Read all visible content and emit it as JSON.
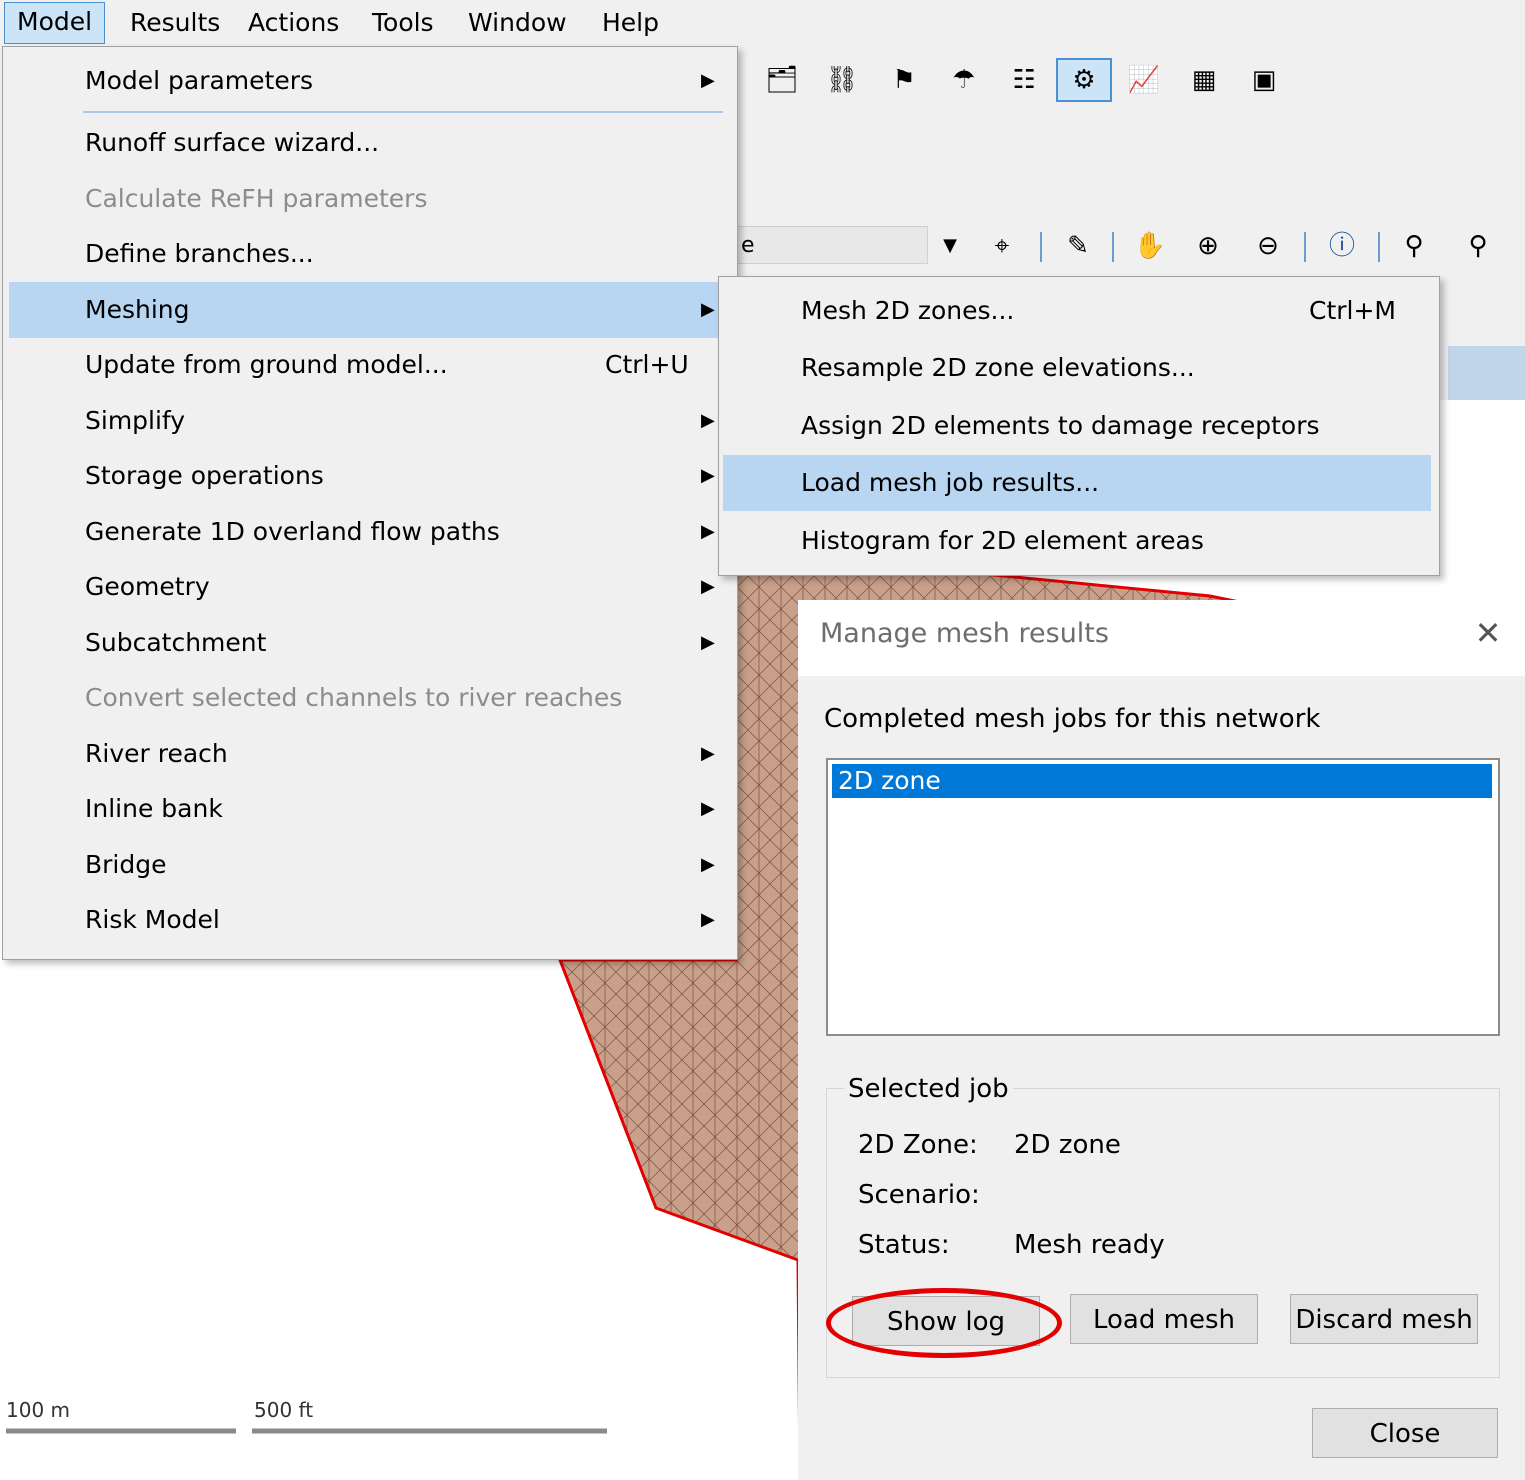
{
  "menubar": {
    "items": [
      "Model",
      "Results",
      "Actions",
      "Tools",
      "Window",
      "Help"
    ]
  },
  "toolbar": {
    "combo_value": "e"
  },
  "model_menu": {
    "items": [
      {
        "label": "Model parameters",
        "submenu": true
      },
      {
        "label": "Runoff surface wizard..."
      },
      {
        "label": "Calculate ReFH parameters",
        "disabled": true
      },
      {
        "label": "Define branches..."
      },
      {
        "label": "Meshing",
        "submenu": true,
        "highlighted": true
      },
      {
        "label": "Update from ground model...",
        "shortcut": "Ctrl+U"
      },
      {
        "label": "Simplify",
        "submenu": true
      },
      {
        "label": "Storage operations",
        "submenu": true
      },
      {
        "label": "Generate 1D overland flow paths",
        "submenu": true
      },
      {
        "label": "Geometry",
        "submenu": true
      },
      {
        "label": "Subcatchment",
        "submenu": true
      },
      {
        "label": "Convert selected channels to river reaches",
        "disabled": true
      },
      {
        "label": "River reach",
        "submenu": true
      },
      {
        "label": "Inline bank",
        "submenu": true
      },
      {
        "label": "Bridge",
        "submenu": true
      },
      {
        "label": "Risk Model",
        "submenu": true
      }
    ]
  },
  "meshing_submenu": {
    "items": [
      {
        "label": "Mesh 2D zones...",
        "shortcut": "Ctrl+M"
      },
      {
        "label": "Resample 2D zone elevations..."
      },
      {
        "label": "Assign 2D elements to damage receptors"
      },
      {
        "label": "Load mesh job results...",
        "highlighted": true
      },
      {
        "label": "Histogram for 2D element areas"
      }
    ]
  },
  "scale_bar": {
    "metric": "100 m",
    "imperial": "500 ft"
  },
  "dialog": {
    "title": "Manage mesh results",
    "list_label": "Completed mesh jobs for this network",
    "jobs": [
      "2D zone"
    ],
    "group_title": "Selected job",
    "zone_label": "2D Zone:",
    "zone_value": "2D zone",
    "scenario_label": "Scenario:",
    "scenario_value": "",
    "status_label": "Status:",
    "status_value": "Mesh ready",
    "buttons": {
      "show_log": "Show log",
      "load_mesh": "Load mesh",
      "discard_mesh": "Discard mesh",
      "close": "Close"
    }
  },
  "colors": {
    "highlight": "#b8d6f2",
    "selection": "#0078d7",
    "mesh_fill": "#c9a08a",
    "boundary": "#e20000"
  }
}
